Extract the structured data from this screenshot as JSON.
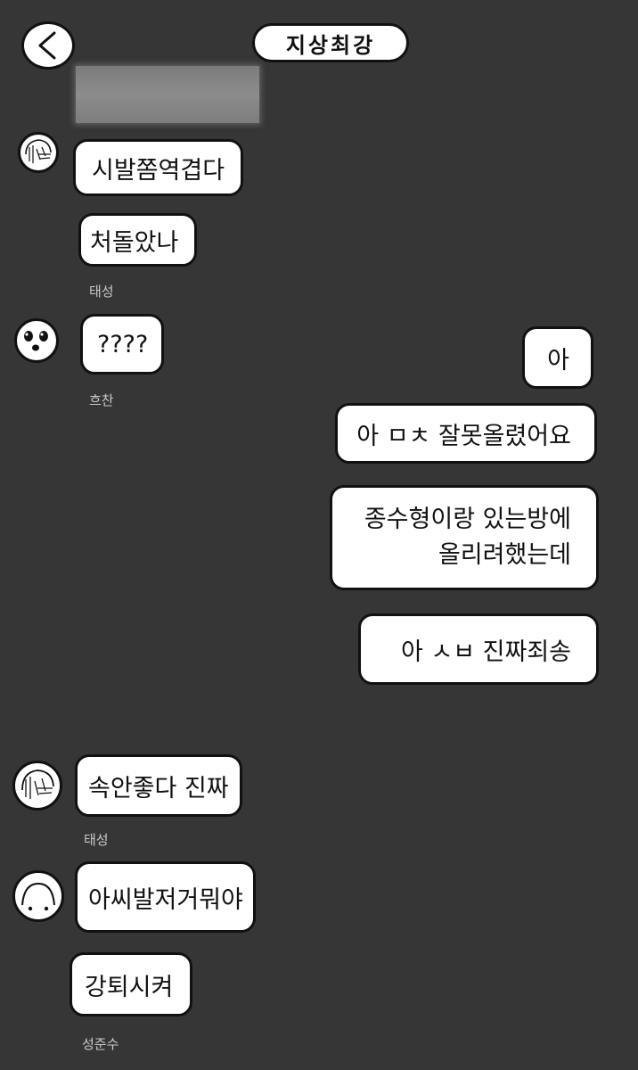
{
  "header": {
    "back_icon": "chevron-left-icon",
    "title": "지상최강"
  },
  "messages": [
    {
      "id": "m1",
      "side": "left",
      "sender": "태성",
      "text": "시발쫌역겹다",
      "avatar": "hair-face-icon"
    },
    {
      "id": "m2",
      "side": "left",
      "sender": "태성",
      "text": "처돌았나"
    },
    {
      "id": "m3",
      "side": "left",
      "sender": "흐찬",
      "text": "????",
      "avatar": "surprised-face-icon"
    },
    {
      "id": "m4",
      "side": "right",
      "text": "아"
    },
    {
      "id": "m5",
      "side": "right",
      "text": "아 ㅁㅊ 잘못올렸어요"
    },
    {
      "id": "m6",
      "side": "right",
      "lines": [
        "종수형이랑 있는방에",
        "올리려했는데"
      ]
    },
    {
      "id": "m7",
      "side": "right",
      "text": "아 ㅅㅂ 진짜죄송"
    },
    {
      "id": "m8",
      "side": "left",
      "sender": "태성",
      "text": "속안좋다 진짜",
      "avatar": "hair-face-icon"
    },
    {
      "id": "m9",
      "side": "left",
      "sender": "성준수",
      "text": "아씨발저거뭐야",
      "avatar": "arc-face-icon"
    },
    {
      "id": "m10",
      "side": "left",
      "sender": "성준수",
      "text": "강퇴시켜"
    }
  ],
  "names": {
    "group1": "태성",
    "group2": "흐찬",
    "group3": "태성",
    "group4": "성준수"
  }
}
